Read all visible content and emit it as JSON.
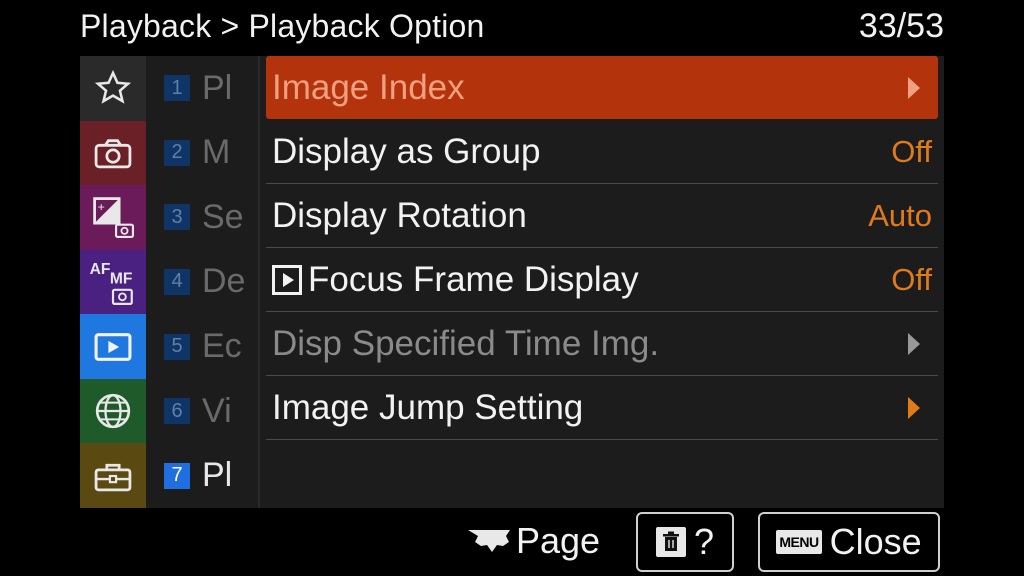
{
  "header": {
    "breadcrumb": "Playback > Playback Option",
    "page_counter": "33/53"
  },
  "categories": [
    {
      "icon": "star-icon",
      "color": "#2a2a2a",
      "active": false
    },
    {
      "icon": "camera-icon",
      "color": "#6b1f26",
      "active": false
    },
    {
      "icon": "exposure-camera-icon",
      "color": "#6b1b5a",
      "active": false
    },
    {
      "icon": "af-mf-camera-icon",
      "color": "#4a2080",
      "active": false
    },
    {
      "icon": "playback-icon",
      "color": "#1e78e0",
      "active": true
    },
    {
      "icon": "globe-icon",
      "color": "#1f5a2a",
      "active": false
    },
    {
      "icon": "toolbox-icon",
      "color": "#5a4a12",
      "active": false
    }
  ],
  "subcategories": [
    {
      "num": "1",
      "label": "Pl"
    },
    {
      "num": "2",
      "label": "M"
    },
    {
      "num": "3",
      "label": "Se"
    },
    {
      "num": "4",
      "label": "De"
    },
    {
      "num": "5",
      "label": "Ec"
    },
    {
      "num": "6",
      "label": "Vi"
    },
    {
      "num": "7",
      "label": "Pl"
    }
  ],
  "menu": {
    "items": [
      {
        "label": "Image Index",
        "value": ""
      },
      {
        "label": "Display as Group",
        "value": "Off"
      },
      {
        "label": "Display Rotation",
        "value": "Auto"
      },
      {
        "label": "Focus Frame Display",
        "value": "Off"
      },
      {
        "label": "Disp Specified Time Img.",
        "value": ""
      },
      {
        "label": "Image Jump Setting",
        "value": ""
      }
    ]
  },
  "footer": {
    "page_label": "Page",
    "help_label": "?",
    "menu_tag": "MENU",
    "close_label": "Close"
  },
  "colors": {
    "selected_bg": "#b3330c",
    "value_orange": "#e07a1a",
    "active_sub": "#1f6fe0"
  }
}
